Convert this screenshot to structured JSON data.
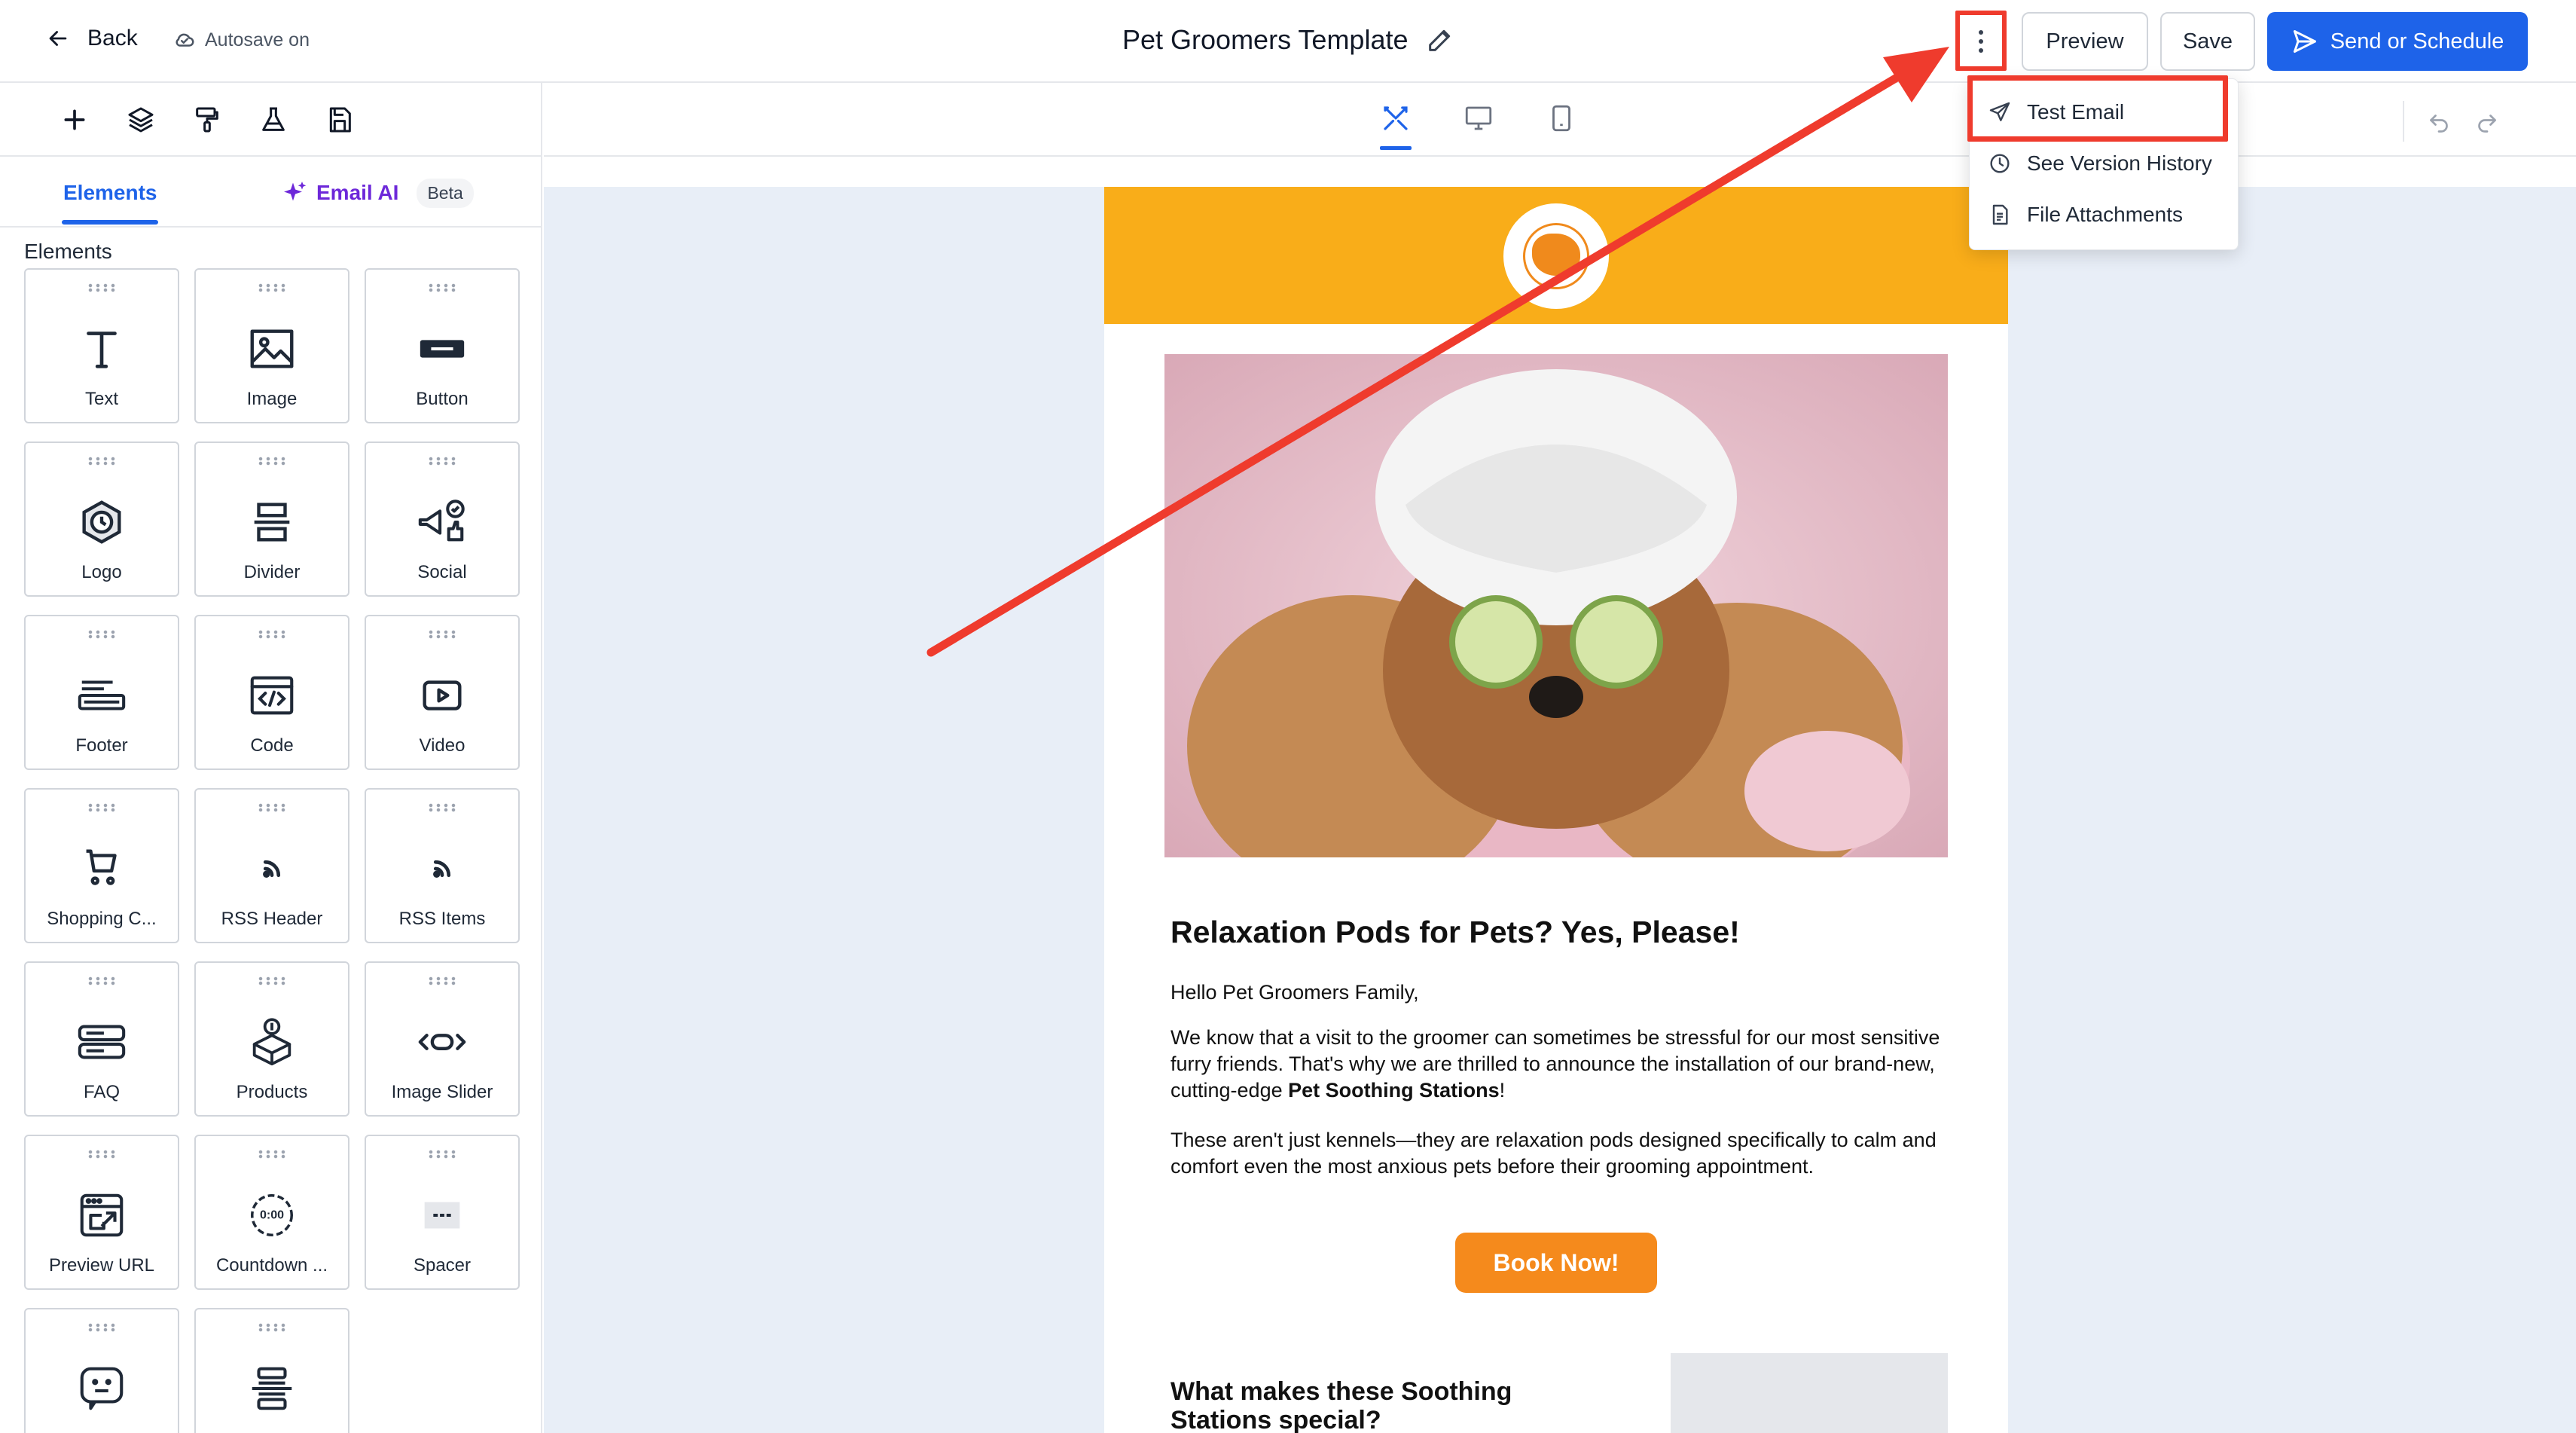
{
  "header": {
    "back_label": "Back",
    "autosave_label": "Autosave on",
    "title": "Pet Groomers Template",
    "preview_label": "Preview",
    "save_label": "Save",
    "send_label": "Send or Schedule"
  },
  "sidebar": {
    "tabs": {
      "elements": "Elements",
      "email_ai": "Email AI",
      "beta": "Beta"
    },
    "section_title": "Elements",
    "elements": [
      {
        "label": "Text",
        "icon": "text-icon"
      },
      {
        "label": "Image",
        "icon": "image-icon"
      },
      {
        "label": "Button",
        "icon": "button-icon"
      },
      {
        "label": "Logo",
        "icon": "logo-icon"
      },
      {
        "label": "Divider",
        "icon": "divider-icon"
      },
      {
        "label": "Social",
        "icon": "social-icon"
      },
      {
        "label": "Footer",
        "icon": "footer-icon"
      },
      {
        "label": "Code",
        "icon": "code-icon"
      },
      {
        "label": "Video",
        "icon": "video-icon"
      },
      {
        "label": "Shopping C...",
        "icon": "cart-icon"
      },
      {
        "label": "RSS Header",
        "icon": "rss-icon"
      },
      {
        "label": "RSS Items",
        "icon": "rss-icon"
      },
      {
        "label": "FAQ",
        "icon": "faq-icon"
      },
      {
        "label": "Products",
        "icon": "products-icon"
      },
      {
        "label": "Image Slider",
        "icon": "slider-icon"
      },
      {
        "label": "Preview URL",
        "icon": "preview-url-icon"
      },
      {
        "label": "Countdown ...",
        "icon": "countdown-icon"
      },
      {
        "label": "Spacer",
        "icon": "spacer-icon"
      },
      {
        "label": "",
        "icon": "chat-icon"
      },
      {
        "label": "",
        "icon": "stack-icon"
      }
    ]
  },
  "dropdown": {
    "items": [
      {
        "label": "Test Email",
        "icon": "send-icon"
      },
      {
        "label": "See Version History",
        "icon": "history-icon"
      },
      {
        "label": "File Attachments",
        "icon": "file-icon"
      }
    ]
  },
  "email": {
    "headline": "Relaxation Pods for Pets? Yes, Please!",
    "greeting": "Hello Pet Groomers Family,",
    "para1_before": "We know that a visit to the groomer can sometimes be stressful for our most sensitive furry friends. That's why we are thrilled to announce the installation of our brand-new, cutting-edge ",
    "para1_bold": "Pet Soothing Stations",
    "para1_after": "!",
    "para2": "These aren't just kennels—they are relaxation pods designed specifically to calm and comfort even the most anxious pets before their grooming appointment.",
    "cta": "Book Now!",
    "subheading": "What makes these Soothing Stations special?"
  },
  "colors": {
    "accent": "#1e63e9",
    "highlight": "#ef3b2d",
    "email_header": "#f9ad19",
    "cta": "#f58a1c",
    "canvas_bg": "#e8eef7"
  }
}
